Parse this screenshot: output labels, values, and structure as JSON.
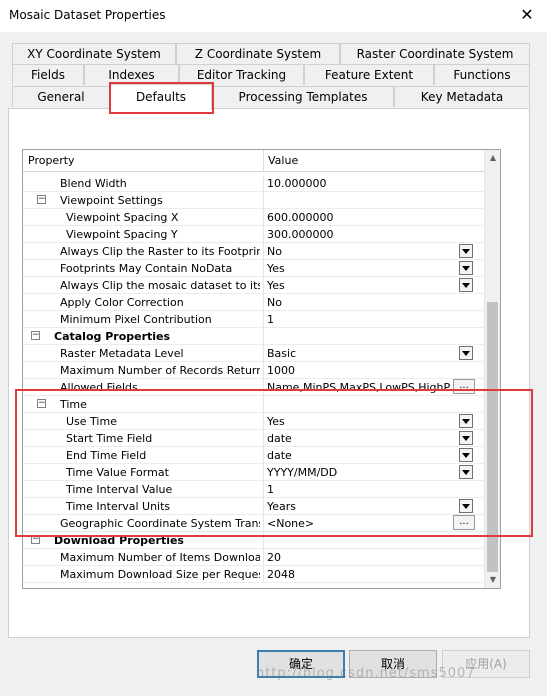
{
  "window": {
    "title": "Mosaic Dataset Properties",
    "close_glyph": "✕"
  },
  "tabs": [
    {
      "label": "XY Coordinate System",
      "active": false
    },
    {
      "label": "Z Coordinate System",
      "active": false
    },
    {
      "label": "Raster Coordinate System",
      "active": false
    },
    {
      "label": "Fields",
      "active": false
    },
    {
      "label": "Indexes",
      "active": false
    },
    {
      "label": "Editor Tracking",
      "active": false
    },
    {
      "label": "Feature Extent",
      "active": false
    },
    {
      "label": "Functions",
      "active": false
    },
    {
      "label": "General",
      "active": false
    },
    {
      "label": "Defaults",
      "active": true
    },
    {
      "label": "Processing Templates",
      "active": false
    },
    {
      "label": "Key Metadata",
      "active": false
    }
  ],
  "grid": {
    "header": {
      "property": "Property",
      "value": "Value"
    },
    "rows": [
      {
        "property": "Blend Width",
        "value": "10.000000",
        "indent": 1,
        "control": "none"
      },
      {
        "property": "Viewpoint Settings",
        "value": "",
        "indent": 1,
        "control": "none",
        "toggle": "−"
      },
      {
        "property": "Viewpoint Spacing X",
        "value": "600.000000",
        "indent": 2,
        "control": "none"
      },
      {
        "property": "Viewpoint Spacing Y",
        "value": "300.000000",
        "indent": 2,
        "control": "none"
      },
      {
        "property": "Always Clip the Raster to its Footprint",
        "value": "No",
        "indent": 1,
        "control": "dropdown"
      },
      {
        "property": "Footprints May Contain NoData",
        "value": "Yes",
        "indent": 1,
        "control": "dropdown"
      },
      {
        "property": "Always Clip the mosaic dataset to its B...",
        "value": "Yes",
        "indent": 1,
        "control": "dropdown"
      },
      {
        "property": "Apply Color Correction",
        "value": "No",
        "indent": 1,
        "control": "none"
      },
      {
        "property": "Minimum Pixel Contribution",
        "value": "1",
        "indent": 1,
        "control": "none"
      },
      {
        "property": "Catalog Properties",
        "value": "",
        "indent": 0,
        "control": "none",
        "toggle": "−",
        "category": true
      },
      {
        "property": "Raster Metadata Level",
        "value": "Basic",
        "indent": 1,
        "control": "dropdown"
      },
      {
        "property": "Maximum Number of Records Returned...",
        "value": "1000",
        "indent": 1,
        "control": "none"
      },
      {
        "property": "Allowed Fields",
        "value": "Name,MinPS,MaxPS,LowPS,HighPS,Ta...",
        "indent": 1,
        "control": "ellipsis"
      },
      {
        "property": "Time",
        "value": "",
        "indent": 1,
        "control": "none",
        "toggle": "−"
      },
      {
        "property": "Use Time",
        "value": "Yes",
        "indent": 2,
        "control": "dropdown"
      },
      {
        "property": "Start Time Field",
        "value": "date",
        "indent": 2,
        "control": "dropdown"
      },
      {
        "property": "End Time Field",
        "value": "date",
        "indent": 2,
        "control": "dropdown"
      },
      {
        "property": "Time Value Format",
        "value": "YYYY/MM/DD",
        "indent": 2,
        "control": "dropdown"
      },
      {
        "property": "Time Interval Value",
        "value": "1",
        "indent": 2,
        "control": "none"
      },
      {
        "property": "Time Interval Units",
        "value": "Years",
        "indent": 2,
        "control": "dropdown"
      },
      {
        "property": "Geographic Coordinate System Transfo...",
        "value": "<None>",
        "indent": 1,
        "control": "ellipsis"
      },
      {
        "property": "Download Properties",
        "value": "",
        "indent": 0,
        "control": "none",
        "toggle": "−",
        "category": true
      },
      {
        "property": "Maximum Number of Items Downloada...",
        "value": "20",
        "indent": 1,
        "control": "none"
      },
      {
        "property": "Maximum Download Size per Request (...",
        "value": "2048",
        "indent": 1,
        "control": "none"
      }
    ]
  },
  "buttons": {
    "ok": "确定",
    "cancel": "取消",
    "apply": "应用(A)"
  },
  "ellipsis_label": "...",
  "scroll": {
    "up": "▲",
    "down": "▼"
  },
  "watermark": "http://blog.csdn.net/sms5007",
  "colors": {
    "highlight": "#e0393e"
  }
}
